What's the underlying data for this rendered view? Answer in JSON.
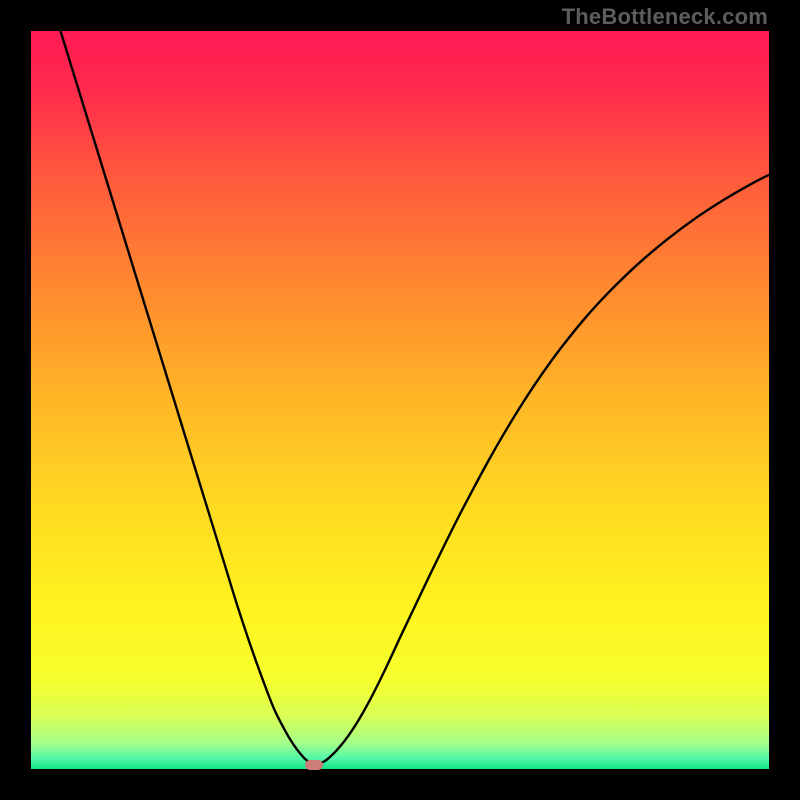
{
  "watermark": {
    "text": "TheBottleneck.com"
  },
  "colors": {
    "black": "#000000",
    "gradient_stops": [
      {
        "pos": 0.0,
        "color": "#ff1a55"
      },
      {
        "pos": 0.08,
        "color": "#ff2b4c"
      },
      {
        "pos": 0.2,
        "color": "#ff5a3c"
      },
      {
        "pos": 0.35,
        "color": "#ff8a2f"
      },
      {
        "pos": 0.5,
        "color": "#ffb626"
      },
      {
        "pos": 0.65,
        "color": "#ffdb21"
      },
      {
        "pos": 0.78,
        "color": "#fff31f"
      },
      {
        "pos": 0.88,
        "color": "#f6ff2e"
      },
      {
        "pos": 0.93,
        "color": "#d7ff57"
      },
      {
        "pos": 0.965,
        "color": "#a4ff8a"
      },
      {
        "pos": 0.985,
        "color": "#55f7a8"
      },
      {
        "pos": 1.0,
        "color": "#12e587"
      }
    ],
    "marker": "#cf7d79",
    "curve": "#000000"
  },
  "layout": {
    "image_size": 800,
    "inner_margin": 31,
    "plot_size": 738
  },
  "chart_data": {
    "type": "line",
    "title": "",
    "xlabel": "",
    "ylabel": "",
    "xlim": [
      0,
      100
    ],
    "ylim": [
      0,
      100
    ],
    "grid": false,
    "legend": false,
    "x": [
      4,
      6,
      8,
      10,
      12,
      14,
      16,
      18,
      20,
      22,
      24,
      26,
      28,
      30,
      32,
      33,
      34,
      35,
      36,
      37,
      37.6,
      38,
      38.6,
      40,
      42,
      44,
      46,
      48,
      50,
      52,
      54,
      56,
      58,
      60,
      62,
      64,
      66,
      68,
      70,
      72,
      75,
      78,
      82,
      86,
      90,
      94,
      98,
      100
    ],
    "y": [
      100,
      93.5,
      87,
      80.5,
      74,
      67.5,
      61,
      54.5,
      48,
      41.5,
      35,
      28.5,
      22,
      16,
      10.5,
      8,
      6,
      4.2,
      2.7,
      1.5,
      1.0,
      0.6,
      0.6,
      1.2,
      3.2,
      6.0,
      9.5,
      13.5,
      17.8,
      22.0,
      26.2,
      30.3,
      34.3,
      38.1,
      41.8,
      45.3,
      48.6,
      51.7,
      54.6,
      57.3,
      61.0,
      64.3,
      68.2,
      71.6,
      74.6,
      77.2,
      79.5,
      80.5
    ],
    "minimum_marker": {
      "x": 38.3,
      "y": 0.5
    }
  }
}
